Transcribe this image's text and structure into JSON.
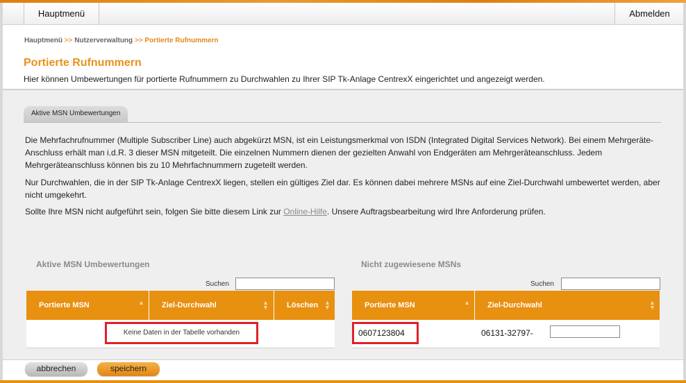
{
  "header": {
    "menu_label": "Hauptmenü",
    "logout_label": "Abmelden"
  },
  "breadcrumb": {
    "items": [
      "Hauptmenü",
      "Nutzerverwaltung",
      "Portierte Rufnummern"
    ],
    "separator": ">>"
  },
  "page": {
    "title": "Portierte Rufnummern",
    "intro": "Hier können Umbewertungen für portierte Rufnummern zu Durchwahlen zu Ihrer SIP Tk-Anlage CentrexX eingerichtet und angezeigt werden."
  },
  "tab": {
    "label": "Aktive MSN Umbewertungen"
  },
  "content": {
    "para1": "Die Mehrfachrufnummer (Multiple Subscriber Line) auch abgekürzt MSN, ist ein Leistungsmerkmal von ISDN (Integrated Digital Services Network). Bei einem Mehrgeräte-Anschluss erhält man i.d.R. 3 dieser MSN mitgeteilt. Die einzelnen Nummern dienen der gezielten Anwahl von Endgeräten am Mehrgeräteanschluss. Jedem Mehrgeräteanschluss können bis zu 10 Mehrfachnummern zugeteilt werden.",
    "para2": "Nur Durchwahlen, die in der SIP Tk-Anlage CentrexX liegen, stellen ein gültiges Ziel dar. Es können dabei mehrere MSNs auf eine Ziel-Durchwahl umbewertet werden, aber nicht umgekehrt.",
    "para3_before": "Sollte Ihre MSN nicht aufgeführt sein, folgen Sie bitte diesem Link zur ",
    "para3_link": "Online-Hilfe",
    "para3_after": ". Unsere Auftragsbearbeitung wird Ihre Anforderung prüfen."
  },
  "active_table": {
    "title": "Aktive MSN Umbewertungen",
    "search_label": "Suchen",
    "search_value": "",
    "columns": [
      "Portierte MSN",
      "Ziel-Durchwahl",
      "Löschen"
    ],
    "empty_text": "Keine Daten in der Tabelle vorhanden"
  },
  "unassigned_table": {
    "title": "Nicht zugewiesene MSNs",
    "search_label": "Suchen",
    "search_value": "",
    "columns": [
      "Portierte MSN",
      "Ziel-Durchwahl"
    ],
    "rows": [
      {
        "msn": "0607123804",
        "ziel_prefix": "06131-32797-",
        "ziel_input": ""
      }
    ]
  },
  "buttons": {
    "cancel": "abbrechen",
    "save": "speichern"
  },
  "colors": {
    "accent": "#e8900f",
    "title": "#e8921a",
    "highlight": "#e0202a"
  }
}
